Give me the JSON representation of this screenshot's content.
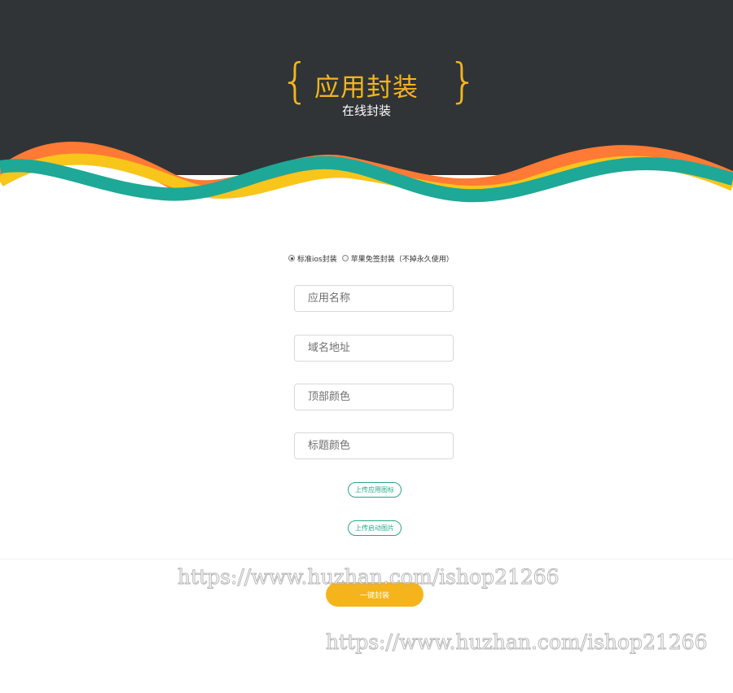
{
  "header": {
    "title": "应用封装",
    "subtitle": "在线封装",
    "brace_left": "{",
    "brace_right": "}",
    "background_color": "#303436",
    "accent_color": "#f3b51f",
    "wave_colors": [
      "#ff7a34",
      "#f8c51b",
      "#1ea897"
    ]
  },
  "form": {
    "mode_options": [
      {
        "label": "标准ios封装",
        "checked": true
      },
      {
        "label": "苹果免签封装（不掉永久使用）",
        "checked": false
      }
    ],
    "app_name_placeholder": "应用名称",
    "domain_placeholder": "域名地址",
    "top_color_placeholder": "顶部颜色",
    "title_color_placeholder": "标题颜色",
    "upload_icon_label": "上传应用图标",
    "upload_launch_label": "上传启动图片",
    "submit_label": "一键封装",
    "submit_color": "#f5b41c",
    "outline_color": "#25a987"
  },
  "watermarks": [
    "https://www.huzhan.com/ishop21266",
    "https://www.huzhan.com/ishop21266"
  ]
}
